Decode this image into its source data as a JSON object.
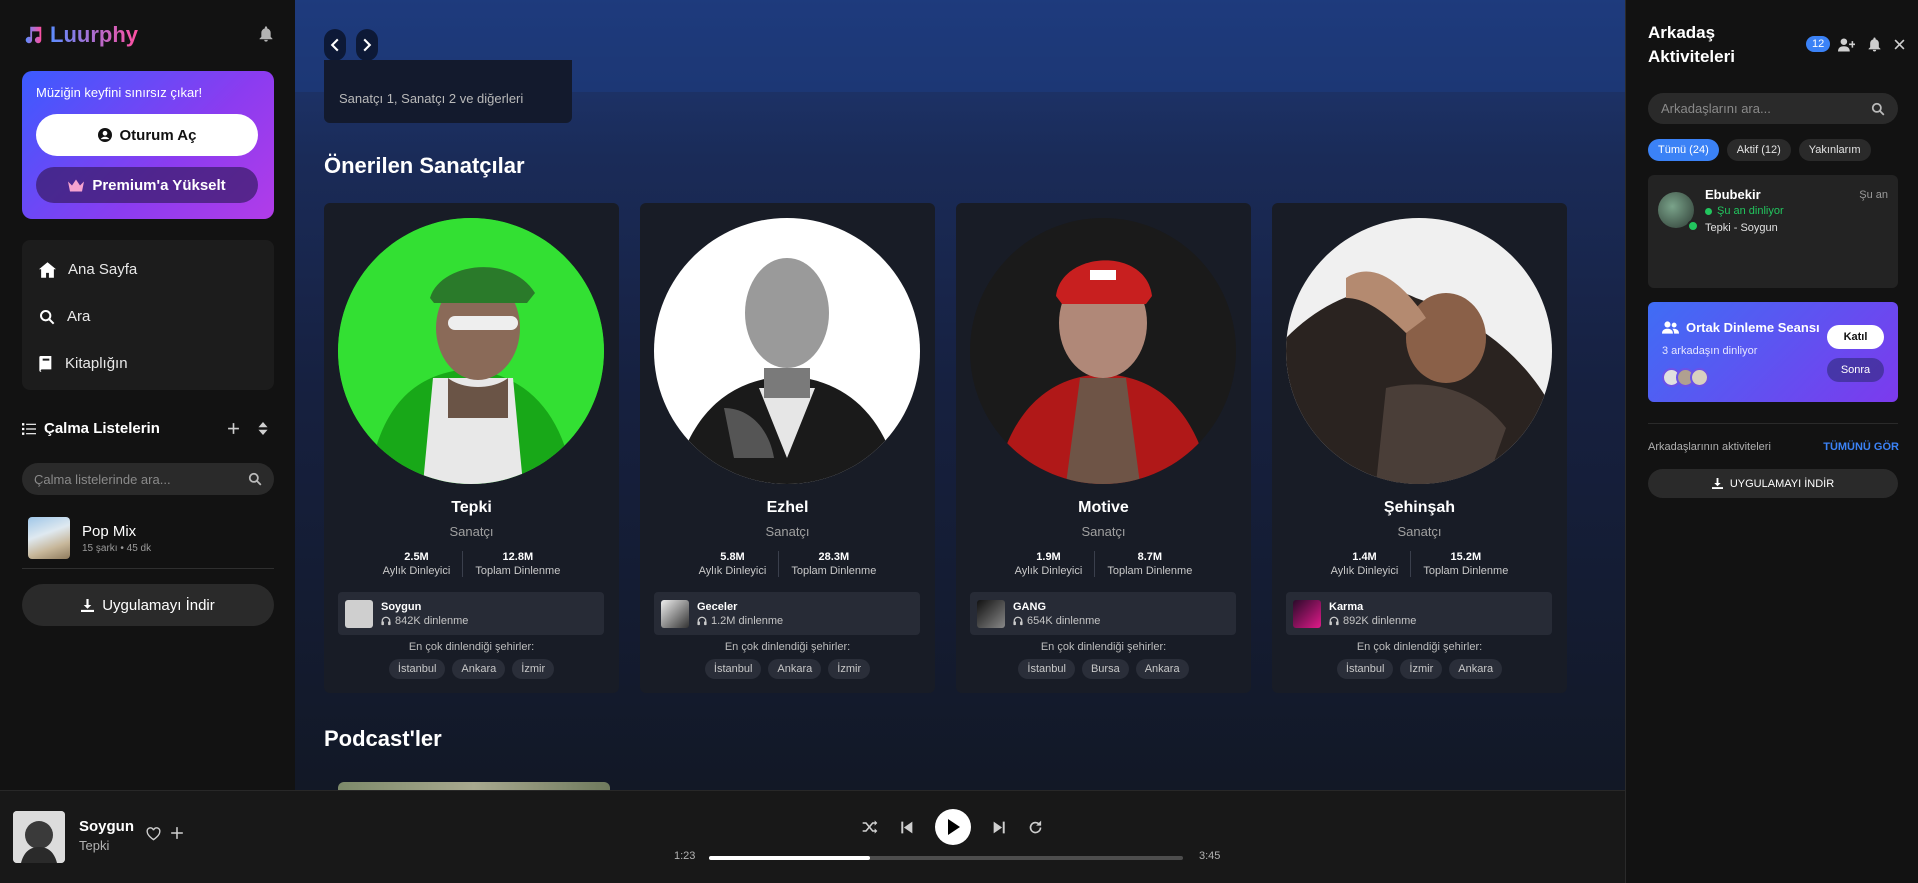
{
  "app": {
    "name": "Luurphy"
  },
  "promo": {
    "text": "Müziğin keyfini sınırsız çıkar!",
    "login_label": "Oturum Aç",
    "premium_label": "Premium'a Yükselt"
  },
  "nav": [
    {
      "label": "Ana Sayfa",
      "icon": "home-icon"
    },
    {
      "label": "Ara",
      "icon": "search-icon"
    },
    {
      "label": "Kitaplığın",
      "icon": "library-icon"
    }
  ],
  "playlists": {
    "title": "Çalma Listelerin",
    "search_placeholder": "Çalma listelerinde ara...",
    "items": [
      {
        "title": "Pop Mix",
        "subtitle": "15 şarkı • 45 dk"
      }
    ]
  },
  "download_app_label": "Uygulamayı İndir",
  "main": {
    "recent_subtitle": "Sanatçı 1, Sanatçı 2 ve diğerleri",
    "artists_title": "Önerilen Sanatçılar",
    "podcasts_title": "Podcast'ler",
    "artists": [
      {
        "name": "Tepki",
        "role": "Sanatçı",
        "monthly": "2.5M",
        "monthly_label": "Aylık Dinleyici",
        "total": "12.8M",
        "total_label": "Toplam Dinlenme",
        "song": "Soygun",
        "plays": "842K dinlenme",
        "cities_label": "En çok dinlendiği şehirler:",
        "cities": [
          "İstanbul",
          "Ankara",
          "İzmir"
        ]
      },
      {
        "name": "Ezhel",
        "role": "Sanatçı",
        "monthly": "5.8M",
        "monthly_label": "Aylık Dinleyici",
        "total": "28.3M",
        "total_label": "Toplam Dinlenme",
        "song": "Geceler",
        "plays": "1.2M dinlenme",
        "cities_label": "En çok dinlendiği şehirler:",
        "cities": [
          "İstanbul",
          "Ankara",
          "İzmir"
        ]
      },
      {
        "name": "Motive",
        "role": "Sanatçı",
        "monthly": "1.9M",
        "monthly_label": "Aylık Dinleyici",
        "total": "8.7M",
        "total_label": "Toplam Dinlenme",
        "song": "GANG",
        "plays": "654K dinlenme",
        "cities_label": "En çok dinlendiği şehirler:",
        "cities": [
          "İstanbul",
          "Bursa",
          "Ankara"
        ]
      },
      {
        "name": "Şehinşah",
        "role": "Sanatçı",
        "monthly": "1.4M",
        "monthly_label": "Aylık Dinleyici",
        "total": "15.2M",
        "total_label": "Toplam Dinlenme",
        "song": "Karma",
        "plays": "892K dinlenme",
        "cities_label": "En çok dinlendiği şehirler:",
        "cities": [
          "İstanbul",
          "İzmir",
          "Ankara"
        ]
      }
    ]
  },
  "player": {
    "title": "Soygun",
    "artist": "Tepki",
    "current": "1:23",
    "total": "3:45",
    "progress": 0.34
  },
  "friends": {
    "title": "Arkadaş Aktiviteleri",
    "badge": "12",
    "search_placeholder": "Arkadaşlarını ara...",
    "tabs": [
      "Tümü (24)",
      "Aktif (12)",
      "Yakınlarım"
    ],
    "items": [
      {
        "name": "Ebubekir",
        "time": "Şu an",
        "status": "Şu an dinliyor",
        "song": "Tepki - Soygun"
      }
    ],
    "session": {
      "title": "Ortak Dinleme Seansı",
      "subtitle": "3 arkadaşın dinliyor",
      "join_label": "Katıl",
      "later_label": "Sonra"
    },
    "activities_label": "Arkadaşlarının aktiviteleri",
    "see_all_label": "TÜMÜNÜ GÖR",
    "download_label": "UYGULAMAYI İNDİR"
  },
  "colors": {
    "accent": "#3b82f6",
    "online": "#22c55e",
    "brand_start": "#5b8cff",
    "brand_end": "#ff4fa0"
  }
}
